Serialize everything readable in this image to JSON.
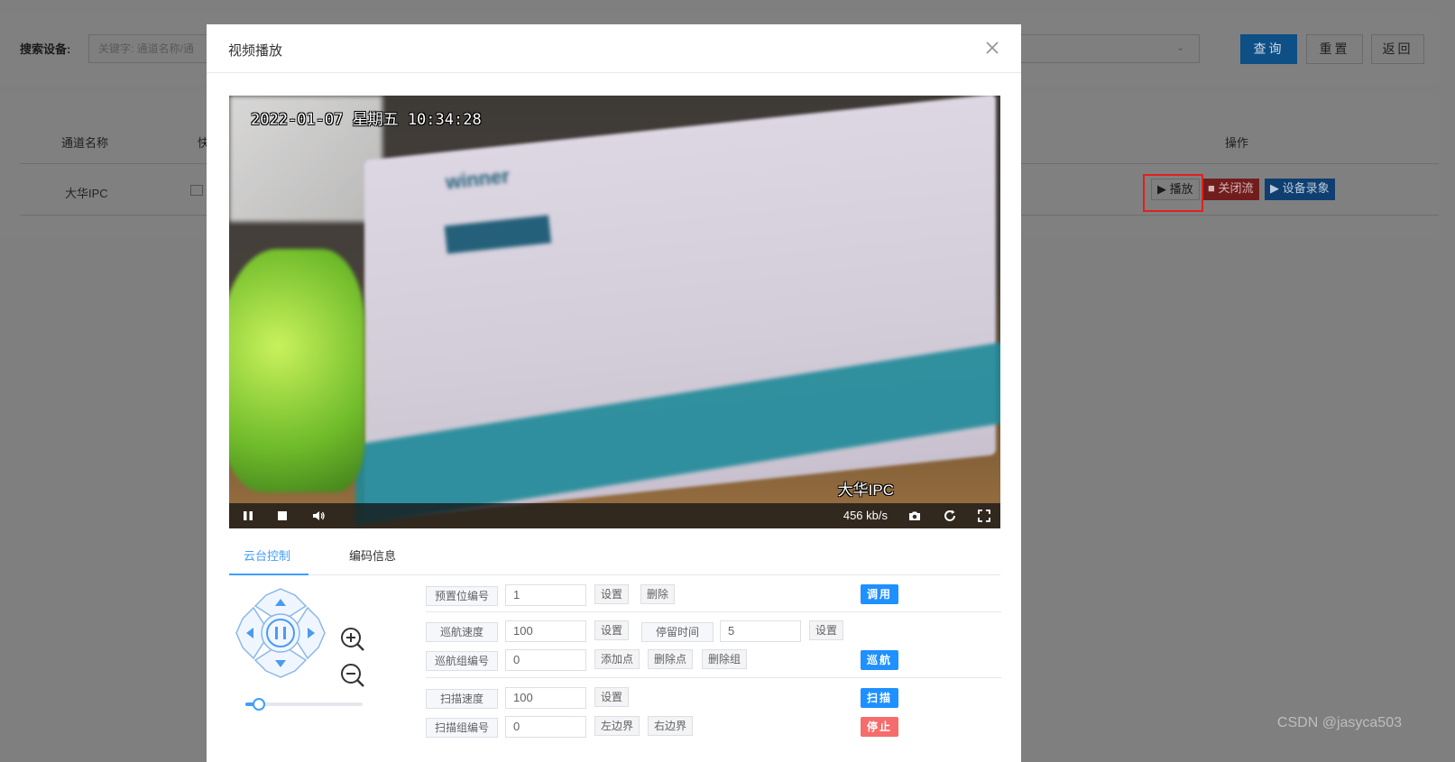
{
  "page": {
    "search_label": "搜索设备:",
    "search_placeholder": "关键字: 通道名称/通",
    "buttons": {
      "query": "查询",
      "reset": "重置",
      "back": "返回"
    },
    "table": {
      "headers": {
        "name": "通道名称",
        "snap": "快",
        "op": "操作"
      },
      "row": {
        "name": "大华IPC"
      },
      "ops": {
        "play": "播放",
        "close_stream": "关闭流",
        "record": "设备录象"
      }
    }
  },
  "dialog": {
    "title": "视频播放",
    "video": {
      "osd_time": "2022-01-07 星期五 10:34:28",
      "osd_name": "大华IPC",
      "bitrate": "456 kb/s"
    },
    "tabs": [
      "云台控制",
      "编码信息"
    ],
    "form": {
      "preset": {
        "label": "预置位编号",
        "value": "1",
        "set": "设置",
        "delete": "删除",
        "call": "调用"
      },
      "cruise": {
        "speed_label": "巡航速度",
        "speed_value": "100",
        "speed_set": "设置",
        "stay_label": "停留时间",
        "stay_value": "5",
        "stay_set": "设置",
        "group_label": "巡航组编号",
        "group_value": "0",
        "add_point": "添加点",
        "del_point": "删除点",
        "del_group": "删除组",
        "start": "巡航"
      },
      "scan": {
        "speed_label": "扫描速度",
        "speed_value": "100",
        "speed_set": "设置",
        "group_label": "扫描组编号",
        "group_value": "0",
        "left": "左边界",
        "right": "右边界",
        "start": "扫描",
        "stop": "停止"
      }
    }
  },
  "watermark": "CSDN @jasyca503"
}
